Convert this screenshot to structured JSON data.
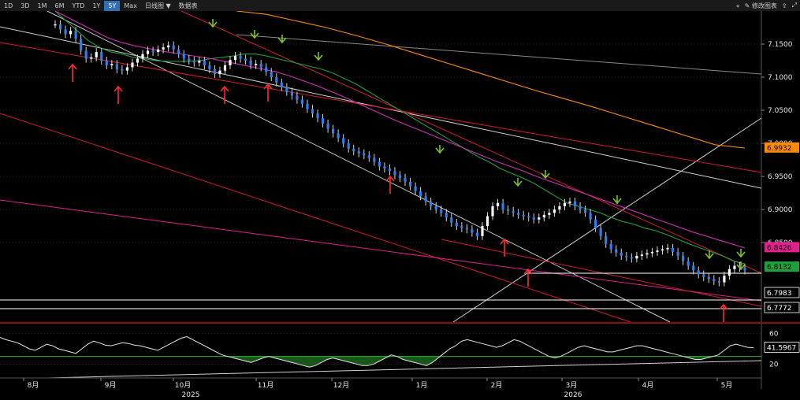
{
  "toolbar": {
    "ranges": [
      "1D",
      "3D",
      "1M",
      "6M",
      "YTD",
      "1Y",
      "5Y",
      "Max"
    ],
    "active_range": "5Y",
    "chart_type": "日线图",
    "chart_type_arrow": "▼",
    "datatable": "数据表",
    "collapse": "«",
    "edit_chart": "修改图表",
    "icons": [
      "pencil-icon",
      "export-icon",
      "expand-icon"
    ]
  },
  "chart_data": [
    {
      "type": "line",
      "title": "",
      "y_ticks": [
        "7.1500",
        "7.1000",
        "7.0500",
        "7.0000",
        "6.9500",
        "6.9000",
        "6.8500"
      ],
      "ylim": [
        6.73,
        7.2
      ],
      "x_ticks": [
        "8月",
        "9月",
        "10月",
        "11月",
        "12月",
        "1月",
        "2月",
        "3月",
        "4月",
        "5月"
      ],
      "x_year_labels": [
        "2025",
        "2026"
      ],
      "price_labels": [
        {
          "value": "6.9932",
          "color": "#ff8c00"
        },
        {
          "value": "6.8426",
          "color": "#e0208c"
        },
        {
          "value": "6.8132",
          "color": "#1fa03a"
        },
        {
          "value": "6.7983",
          "color": "#ffffff"
        },
        {
          "value": "6.7772",
          "color": "#ffffff"
        }
      ],
      "series": [
        {
          "color": "#2d7ff0",
          "values": [
            7.18,
            7.172,
            7.165,
            7.17,
            7.158,
            7.14,
            7.128,
            7.13,
            7.138,
            7.125,
            7.118,
            7.12,
            7.112,
            7.11,
            7.115,
            7.122,
            7.128,
            7.135,
            7.14,
            7.138,
            7.142,
            7.145,
            7.148,
            7.142,
            7.135,
            7.128,
            7.125,
            7.122,
            7.125,
            7.118,
            7.112,
            7.105,
            7.11,
            7.118,
            7.126,
            7.132,
            7.128,
            7.125,
            7.118,
            7.12,
            7.115,
            7.108,
            7.1,
            7.092,
            7.085,
            7.078,
            7.072,
            7.066,
            7.06,
            7.052,
            7.045,
            7.038,
            7.03,
            7.022,
            7.015,
            7.008,
            7.0,
            6.992,
            6.988,
            6.985,
            6.982,
            6.978,
            6.972,
            6.965,
            6.962,
            6.958,
            6.952,
            6.948,
            6.942,
            6.935,
            6.928,
            6.92,
            6.912,
            6.905,
            6.9,
            6.895,
            6.888,
            6.88,
            6.875,
            6.872,
            6.87,
            6.865,
            6.86,
            6.875,
            6.89,
            6.905,
            6.91,
            6.9,
            6.898,
            6.895,
            6.892,
            6.89,
            6.888,
            6.885,
            6.888,
            6.892,
            6.895,
            6.9,
            6.905,
            6.91,
            6.912,
            6.905,
            6.9,
            6.895,
            6.885,
            6.872,
            6.86,
            6.848,
            6.84,
            6.835,
            6.83,
            6.828,
            6.826,
            6.83,
            6.832,
            6.834,
            6.836,
            6.838,
            6.84,
            6.842,
            6.836,
            6.83,
            6.822,
            6.815,
            6.808,
            6.802,
            6.798,
            6.795,
            6.792,
            6.79,
            6.8,
            6.81,
            6.815,
            6.812,
            6.808
          ]
        },
        {
          "color": "#1fa03a",
          "values": [
            7.2,
            7.185,
            7.17,
            7.155,
            7.145,
            7.138,
            7.135,
            7.13,
            7.128,
            7.125,
            7.124,
            7.124,
            7.124,
            7.125,
            7.128,
            7.13,
            7.132,
            7.135,
            7.135,
            7.132,
            7.128,
            7.124,
            7.12,
            7.116,
            7.112,
            7.106,
            7.098,
            7.09,
            7.08,
            7.07,
            7.06,
            7.05,
            7.04,
            7.03,
            7.02,
            7.01,
            7.0,
            6.99,
            6.98,
            6.972,
            6.962,
            6.955,
            6.948,
            6.94,
            6.93,
            6.92,
            6.91,
            6.905,
            6.9,
            6.895,
            6.888,
            6.882,
            6.878,
            6.872,
            6.868,
            6.862,
            6.855,
            6.848,
            6.842,
            6.836,
            6.83,
            6.822,
            6.818
          ]
        },
        {
          "color": "#cc2fb8",
          "values": [
            7.2,
            7.19,
            7.18,
            7.17,
            7.16,
            7.153,
            7.148,
            7.144,
            7.14,
            7.137,
            7.134,
            7.131,
            7.128,
            7.124,
            7.12,
            7.116,
            7.112,
            7.108,
            7.102,
            7.095,
            7.088,
            7.08,
            7.072,
            7.063,
            7.054,
            7.045,
            7.036,
            7.028,
            7.02,
            7.012,
            7.004,
            6.996,
            6.988,
            6.98,
            6.972,
            6.965,
            6.958,
            6.95,
            6.943,
            6.936,
            6.929,
            6.922,
            6.915,
            6.908,
            6.901,
            6.894,
            6.887,
            6.88,
            6.873,
            6.866,
            6.86,
            6.854,
            6.848,
            6.842
          ]
        },
        {
          "color": "#ff8c00",
          "values": [
            7.2,
            7.195,
            7.185,
            7.175,
            7.163,
            7.15,
            7.136,
            7.122,
            7.108,
            7.094,
            7.08,
            7.067,
            7.054,
            7.04,
            7.026,
            7.012,
            6.998,
            6.993
          ]
        }
      ],
      "oscillator": {
        "y_ticks": [
          "60",
          "20"
        ],
        "ylim": [
          10,
          70
        ],
        "value_label": "41.5967",
        "values": [
          55,
          52,
          50,
          48,
          44,
          40,
          38,
          42,
          46,
          44,
          40,
          38,
          36,
          34,
          40,
          46,
          50,
          48,
          45,
          44,
          46,
          48,
          47,
          45,
          44,
          42,
          40,
          38,
          42,
          46,
          50,
          54,
          56,
          52,
          48,
          44,
          40,
          36,
          32,
          30,
          28,
          26,
          24,
          22,
          25,
          28,
          30,
          28,
          26,
          24,
          22,
          20,
          18,
          16,
          18,
          22,
          26,
          28,
          26,
          24,
          22,
          20,
          18,
          18,
          20,
          24,
          28,
          32,
          30,
          26,
          24,
          22,
          20,
          18,
          22,
          28,
          34,
          40,
          44,
          50,
          52,
          50,
          48,
          46,
          44,
          42,
          44,
          48,
          52,
          50,
          46,
          42,
          38,
          34,
          30,
          28,
          30,
          34,
          38,
          42,
          44,
          42,
          40,
          38,
          36,
          36,
          38,
          40,
          42,
          44,
          44,
          42,
          40,
          38,
          36,
          34,
          32,
          30,
          28,
          26,
          26,
          28,
          30,
          32,
          38,
          44,
          46,
          44,
          42,
          41.6
        ]
      }
    }
  ]
}
